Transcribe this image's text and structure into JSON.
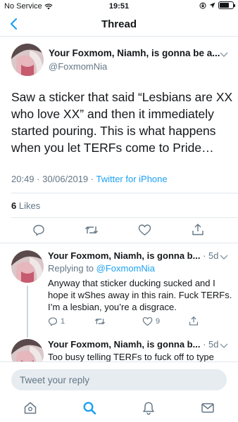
{
  "status_bar": {
    "carrier": "No Service",
    "time": "19:51"
  },
  "nav": {
    "title": "Thread"
  },
  "main_tweet": {
    "author_name": "Your Foxmom, Niamh, is gonna be a...",
    "handle": "@FoxmomNia",
    "text": "Saw a sticker that said “Lesbians are XX who love XX” and then it immediately started pouring. This is what happens when you let TERFs come to Pride…",
    "timestamp": "20:49 · 30/06/2019 · ",
    "source": "Twitter for iPhone",
    "likes_count": "6",
    "likes_label": " Likes"
  },
  "replies": [
    {
      "author_name": "Your Foxmom, Niamh, is gonna b...",
      "meta": " · 5d",
      "replying_label": "Replying to ",
      "replying_handle": "@FoxmomNia",
      "text": "Anyway that sticker ducking sucked and I hope it wShes away in this rain. Fuck TERFs. I’m a lesbian, you’re a disgrace.",
      "reply_count": "1",
      "retweet_count": "",
      "like_count": "9"
    },
    {
      "author_name": "Your Foxmom, Niamh, is gonna b...",
      "meta": " · 5d",
      "text": "Too busy telling TERFs to fuck off to type"
    }
  ],
  "compose": {
    "placeholder": "Tweet your reply"
  },
  "tabs": [
    "home-icon",
    "search-icon",
    "notifications-icon",
    "messages-icon"
  ],
  "colors": {
    "accent": "#1da1f2",
    "secondary_text": "#657786",
    "divider": "#e1e8ed"
  }
}
